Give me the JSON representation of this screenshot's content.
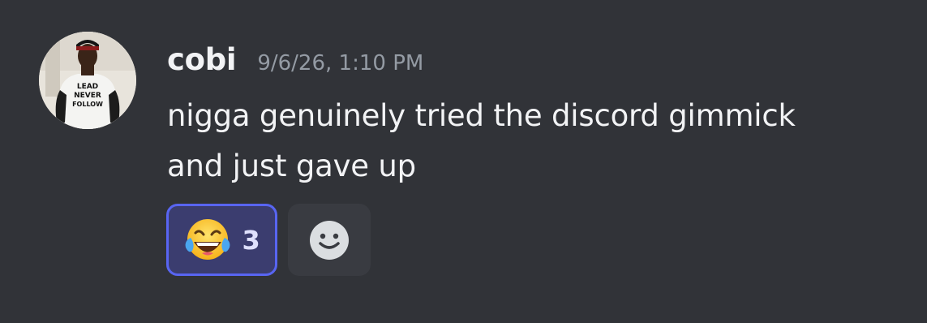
{
  "message": {
    "username": "cobi",
    "timestamp": "9/6/26, 1:10 PM",
    "content_lines": [
      "nigga genuinely tried the discord gimmick",
      "and just gave up"
    ],
    "avatar_shirt_text": [
      "LEAD",
      "NEVER",
      "FOLLOW"
    ],
    "reactions": [
      {
        "emoji": "joy-emoji",
        "count": "3",
        "selected": true
      }
    ],
    "add_reaction_icon": "smiley-face-icon"
  },
  "colors": {
    "background": "#313338",
    "username": "#f2f3f5",
    "timestamp": "#949ba4",
    "reaction_active_bg": "#3b3d6f",
    "reaction_active_border": "#5865f2"
  }
}
